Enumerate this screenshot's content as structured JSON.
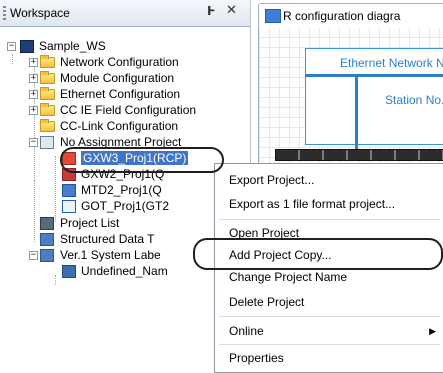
{
  "workspace": {
    "title": "Workspace",
    "pin_glyph": "Ͱ",
    "close_glyph": "✕",
    "tree": {
      "root": "Sample_WS",
      "items": [
        "Network Configuration",
        "Module Configuration",
        "Ethernet Configuration",
        "CC IE Field Configuration",
        "CC-Link Configuration",
        "No Assignment Project",
        "GXW3_Proj1(RCP)",
        "GXW2_Proj1(Q",
        "MTD2_Proj1(Q",
        "GOT_Proj1(GT2",
        "Project List",
        "Structured Data T",
        "Ver.1 System Labe",
        "Undefined_Nam"
      ]
    }
  },
  "design": {
    "tab_label": "R configuration diagra",
    "ethernet_label": "Ethernet  Network N",
    "station_label": "Station No."
  },
  "context_menu": {
    "items": [
      "Export Project...",
      "Export as 1 file format project...",
      "Open Project",
      "Add Project Copy...",
      "Change Project Name",
      "Delete Project",
      "Online",
      "Properties"
    ],
    "submenu_glyph": "▶"
  },
  "colors": {
    "selection": "#3f74c6",
    "network_blue": "#2d7fc9"
  }
}
